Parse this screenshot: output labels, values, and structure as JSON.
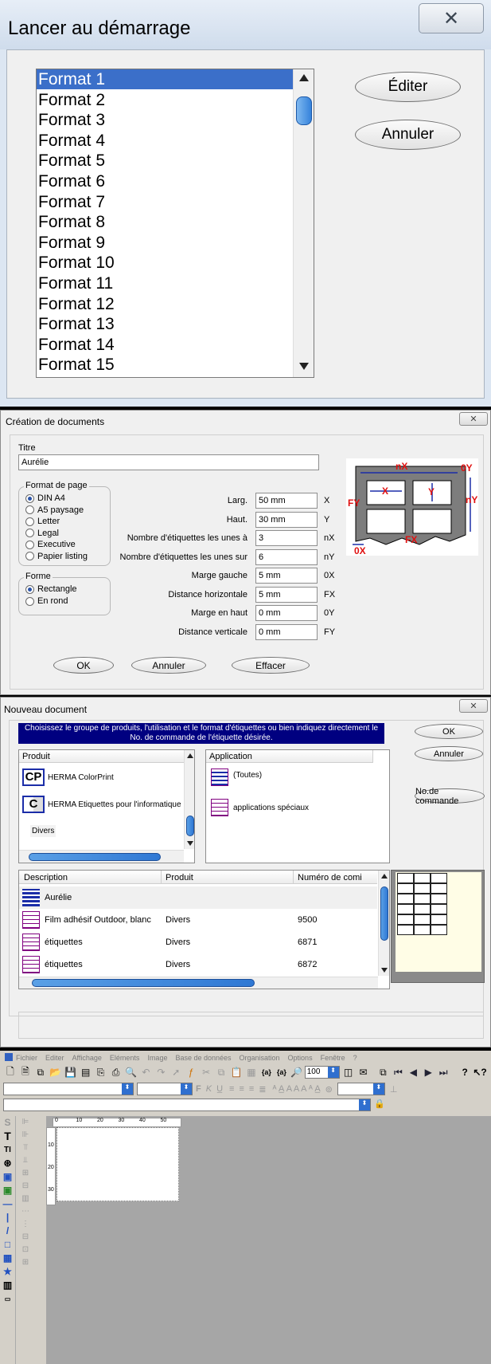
{
  "dialog1": {
    "title": "Lancer au démarrage",
    "formats": [
      "Format 1",
      "Format 2",
      "Format 3",
      "Format 4",
      "Format 5",
      "Format 6",
      "Format 7",
      "Format 8",
      "Format 9",
      "Format 10",
      "Format 11",
      "Format 12",
      "Format 13",
      "Format 14",
      "Format 15"
    ],
    "selected_index": 0,
    "edit_label": "Éditer",
    "cancel_label": "Annuler"
  },
  "dialog2": {
    "title": "Création de documents",
    "titre_label": "Titre",
    "titre_value": "Aurélie",
    "page_format_label": "Format de page",
    "page_formats": [
      "DIN A4",
      "A5 paysage",
      "Letter",
      "Legal",
      "Executive",
      "Papier listing"
    ],
    "page_format_selected": 0,
    "forme_label": "Forme",
    "formes": [
      "Rectangle",
      "En rond"
    ],
    "forme_selected": 0,
    "fields": [
      {
        "label": "Larg.",
        "value": "50 mm",
        "code": "X"
      },
      {
        "label": "Haut.",
        "value": "30 mm",
        "code": "Y"
      },
      {
        "label": "Nombre d'étiquettes les unes à",
        "value": "3",
        "code": "nX"
      },
      {
        "label": "Nombre d'étiquettes les unes sur",
        "value": "6",
        "code": "nY"
      },
      {
        "label": "Marge gauche",
        "value": "5 mm",
        "code": "0X"
      },
      {
        "label": "Distance horizontale",
        "value": "5 mm",
        "code": "FX"
      },
      {
        "label": "Marge en haut",
        "value": "0 mm",
        "code": "0Y"
      },
      {
        "label": "Distance verticale",
        "value": "0 mm",
        "code": "FY"
      }
    ],
    "diagram_labels": {
      "nX": "nX",
      "X": "X",
      "Y": "Y",
      "FY": "FY",
      "OY": "0Y",
      "nY": "nY",
      "OX": "0X",
      "FX": "FX"
    },
    "ok_label": "OK",
    "cancel_label": "Annuler",
    "clear_label": "Effacer"
  },
  "dialog3": {
    "title": "Nouveau document",
    "instruction": "Choisissez le groupe de produits, l'utilisation et le format d'étiquettes ou bien indiquez directement le No. de commande de l'étiquette désirée.",
    "ok_label": "OK",
    "cancel_label": "Annuler",
    "order_label": "No.de commande",
    "product_header": "Produit",
    "products": [
      {
        "icon": "CP",
        "name": "HERMA ColorPrint"
      },
      {
        "icon": "C",
        "name": "HERMA Etiquettes pour l'informatique"
      },
      {
        "icon": "",
        "name": "Divers"
      }
    ],
    "application_header": "Application",
    "applications": [
      "(Toutes)",
      "applications spéciaux"
    ],
    "columns": [
      "Description",
      "Produit",
      "Numéro de comi"
    ],
    "rows": [
      {
        "description": "Aurélie",
        "produit": "",
        "numero": ""
      },
      {
        "description": "Film adhésif Outdoor, blanc",
        "produit": "Divers",
        "numero": "9500"
      },
      {
        "description": "étiquettes",
        "produit": "Divers",
        "numero": "6871"
      },
      {
        "description": "étiquettes",
        "produit": "Divers",
        "numero": "6872"
      }
    ]
  },
  "app": {
    "menu": [
      "Fichier",
      "Editer",
      "Affichage",
      "Eléments",
      "Image",
      "Base de données",
      "Organisation",
      "Options",
      "Fenêtre",
      "?"
    ],
    "zoom": "100",
    "ruler_ticks": [
      "0",
      "10",
      "20",
      "30",
      "40",
      "50"
    ],
    "vruler_ticks": [
      "10",
      "20",
      "30"
    ]
  },
  "colors": {
    "accent": "#3399ff",
    "selection": "#3b6fc9",
    "navy": "#000080",
    "red": "#e01010",
    "panel": "#f0f0f0",
    "chrome": "#cfdff1"
  }
}
